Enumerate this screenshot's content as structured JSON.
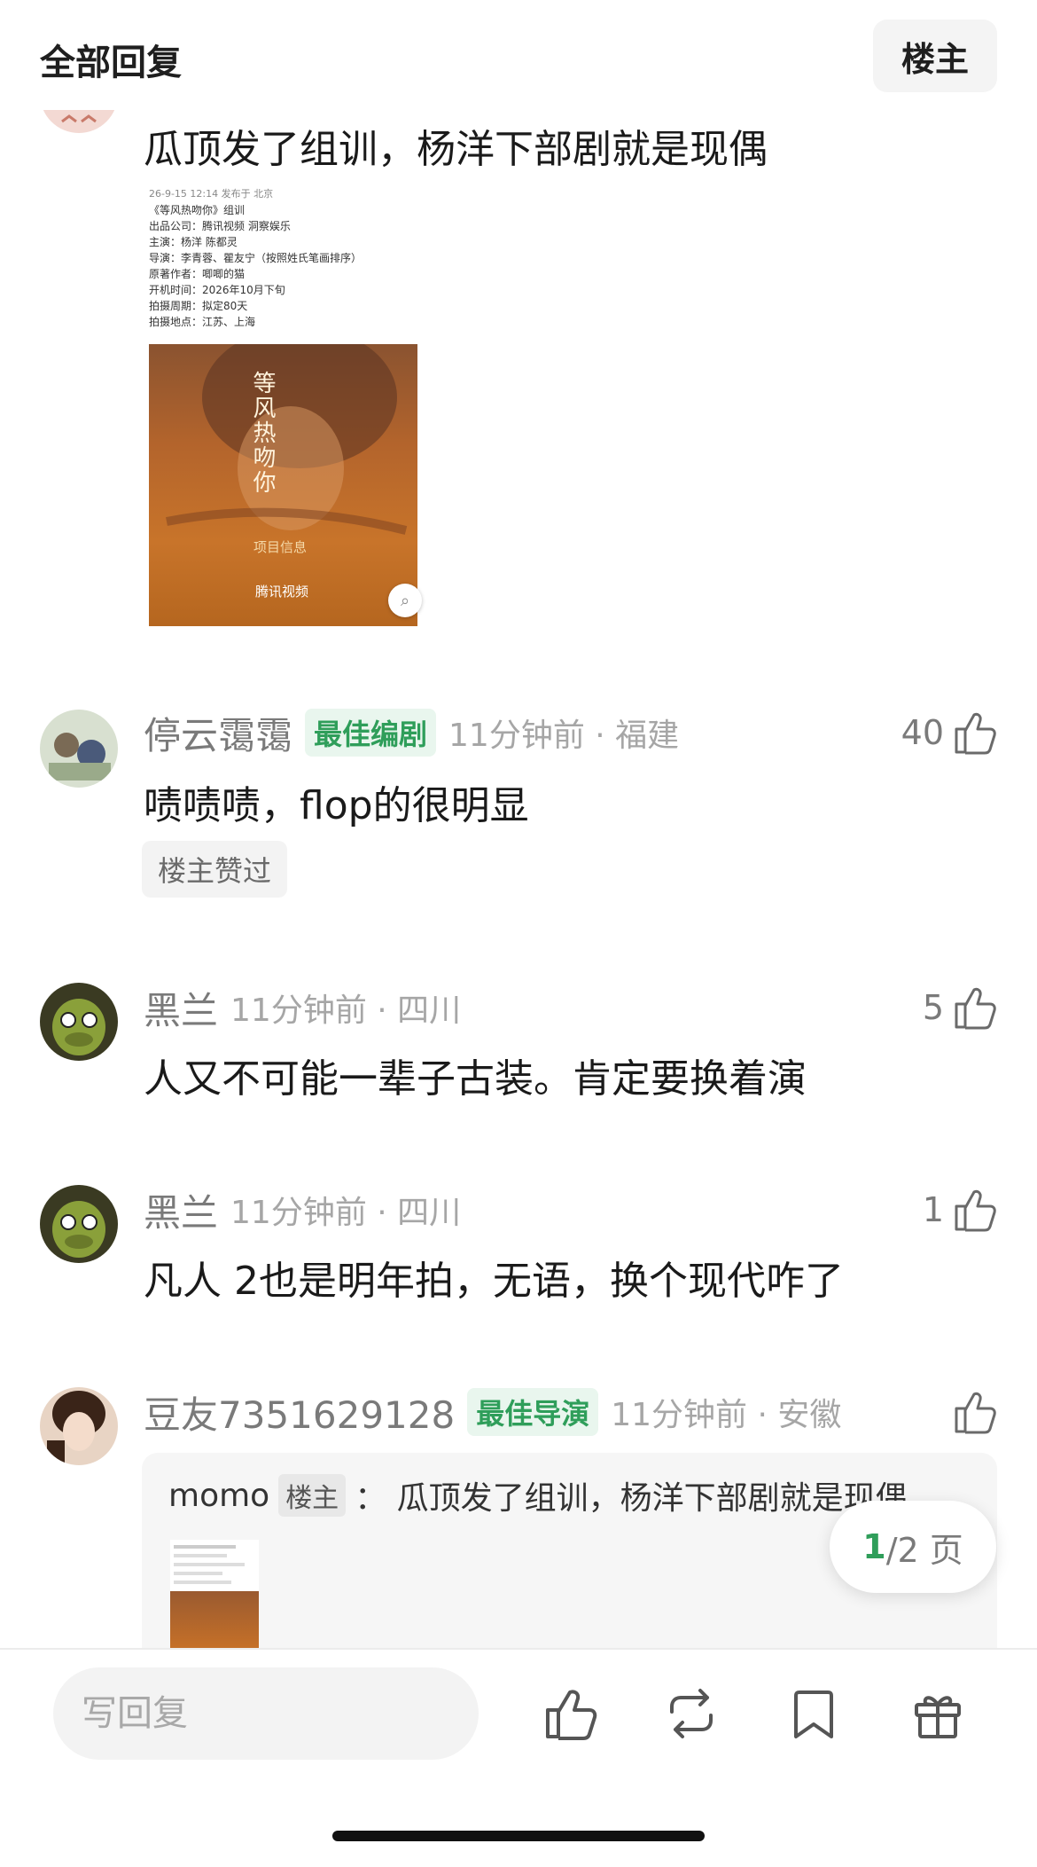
{
  "header": {
    "title": "全部回复",
    "op_button": "楼主"
  },
  "top_post": {
    "text": "瓜顶发了组训，杨洋下部剧就是现偶",
    "embed": {
      "lines": [
        "26-9-15 12:14  发布于 北京",
        "《等风热吻你》组训",
        "出品公司：腾讯视频 洞察娱乐",
        "主演：杨洋 陈都灵",
        "导演：李青蓉、瞿友宁（按照姓氏笔画排序）",
        "原著作者：唧唧的猫",
        "开机时间：2026年10月下旬",
        "拍摄周期：拟定80天",
        "拍摄地点：江苏、上海"
      ],
      "poster_title": "等风热吻你",
      "poster_label": "项目信息",
      "poster_brand": "腾讯视频"
    }
  },
  "comments": [
    {
      "username": "停云霭霭",
      "badge": "最佳编剧",
      "time": "11分钟前 · 福建",
      "likes": "40",
      "text": "啧啧啧，flop的很明显",
      "op_liked": "楼主赞过"
    },
    {
      "username": "黑兰",
      "time": "11分钟前 · 四川",
      "likes": "5",
      "text": "人又不可能一辈子古装。肯定要换着演"
    },
    {
      "username": "黑兰",
      "time": "11分钟前 · 四川",
      "likes": "1",
      "text": "凡人 2也是明年拍，无语，换个现代咋了"
    },
    {
      "username": "豆友7351629128",
      "badge": "最佳导演",
      "time": "11分钟前 · 安徽",
      "quote": {
        "author": "momo",
        "tag": "楼主",
        "text": "： 瓜顶发了组训，杨洋下部剧就是现偶"
      }
    }
  ],
  "pager": {
    "current": "1",
    "rest": "/2 页"
  },
  "bottom_bar": {
    "reply_placeholder": "写回复"
  },
  "colors": {
    "accent": "#2f9e5a",
    "badge_bg": "#e9f6ee",
    "gray_text": "#a6a6a6"
  }
}
